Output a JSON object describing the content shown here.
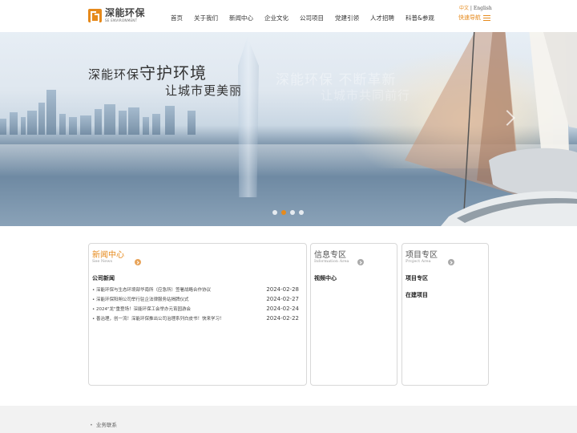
{
  "header": {
    "logo_cn": "深能环保",
    "logo_en": "SE ENVIRONMENT",
    "lang_cn": "中文",
    "lang_sep": " | ",
    "lang_en": "English",
    "nav": [
      "首页",
      "关于我们",
      "新闻中心",
      "企业文化",
      "公司项目",
      "党建引领",
      "人才招聘",
      "科普&参观"
    ],
    "quick_nav": "快速导航"
  },
  "banner": {
    "slogan_prefix": "深能环保",
    "slogan_main": "守护环境",
    "slogan_line2": "让城市更美丽",
    "ghost_line1": "深能环保 不断革新",
    "ghost_line2": "让城市共同前行",
    "slide_count": 4,
    "active_slide": 2
  },
  "news": {
    "title": "新闻中心",
    "subtitle": "See News",
    "section": "公司新闻",
    "items": [
      {
        "title": "• 深能环保与生态环境部华南所（应急所）签署战略合作协议",
        "date": "2024-02-28"
      },
      {
        "title": "• 深能环保阳朔公司举行驻企法律服务站揭牌仪式",
        "date": "2024-02-27"
      },
      {
        "title": "• 2024\"龙\"重登场！深能环保工会举办元宵园游会",
        "date": "2024-02-24"
      },
      {
        "title": "• 善治理，创一流！深能环保推出公司治理系列白皮书！快来学习！",
        "date": "2024-02-22"
      }
    ]
  },
  "info": {
    "title": "信息专区",
    "subtitle": "Information Area",
    "section": "视频中心"
  },
  "project": {
    "title": "项目专区",
    "subtitle": "Project Area",
    "links": [
      "项目专区",
      "在建项目"
    ]
  },
  "footer": {
    "item": "业务联系"
  },
  "colors": {
    "accent": "#e68a1c"
  }
}
